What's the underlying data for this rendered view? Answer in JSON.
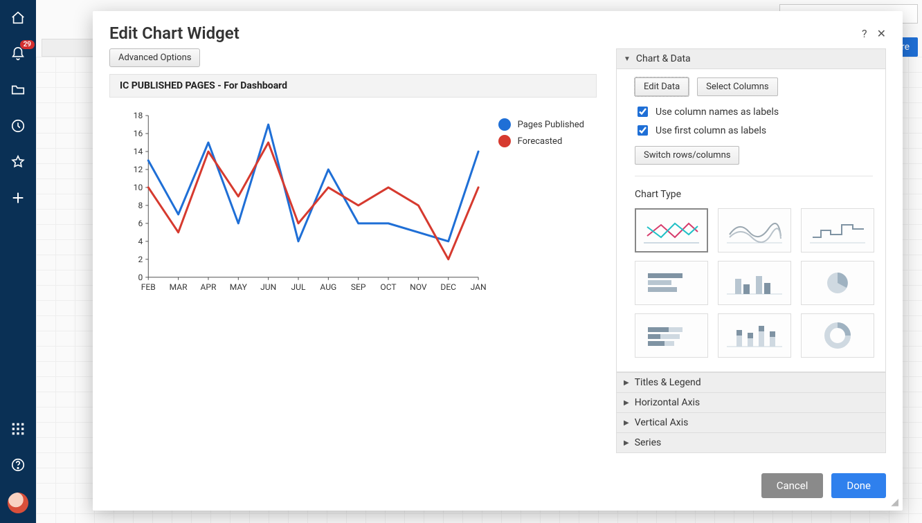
{
  "topbar": {
    "share_label": "Share"
  },
  "sidebar": {
    "badge": "29"
  },
  "modal": {
    "title": "Edit Chart Widget",
    "advanced_label": "Advanced Options",
    "chart_title": "IC PUBLISHED PAGES - For Dashboard",
    "legend": {
      "series1": "Pages Published",
      "series2": "Forecasted"
    },
    "panel": {
      "section_chart_data": "Chart & Data",
      "edit_data": "Edit Data",
      "select_columns": "Select Columns",
      "opt_col_names": "Use column names as labels",
      "opt_first_col": "Use first column as labels",
      "switch": "Switch rows/columns",
      "chart_type_label": "Chart Type",
      "section_titles": "Titles & Legend",
      "section_haxis": "Horizontal Axis",
      "section_vaxis": "Vertical Axis",
      "section_series": "Series"
    },
    "footer": {
      "cancel": "Cancel",
      "done": "Done"
    }
  },
  "chart_data": {
    "type": "line",
    "categories": [
      "FEB",
      "MAR",
      "APR",
      "MAY",
      "JUN",
      "JUL",
      "AUG",
      "SEP",
      "OCT",
      "NOV",
      "DEC",
      "JAN"
    ],
    "series": [
      {
        "name": "Pages Published",
        "color": "#1f6fd6",
        "values": [
          13,
          7,
          15,
          6,
          17,
          4,
          12,
          6,
          6,
          5,
          4,
          14
        ]
      },
      {
        "name": "Forecasted",
        "color": "#d63a2f",
        "values": [
          10,
          5,
          14,
          9,
          15,
          6,
          10,
          8,
          10,
          8,
          2,
          10
        ]
      }
    ],
    "y_ticks": [
      0,
      2,
      4,
      6,
      8,
      10,
      12,
      14,
      16,
      18
    ],
    "ylim": [
      0,
      18
    ],
    "xlabel": "",
    "ylabel": "",
    "title": "IC PUBLISHED PAGES - For Dashboard"
  }
}
